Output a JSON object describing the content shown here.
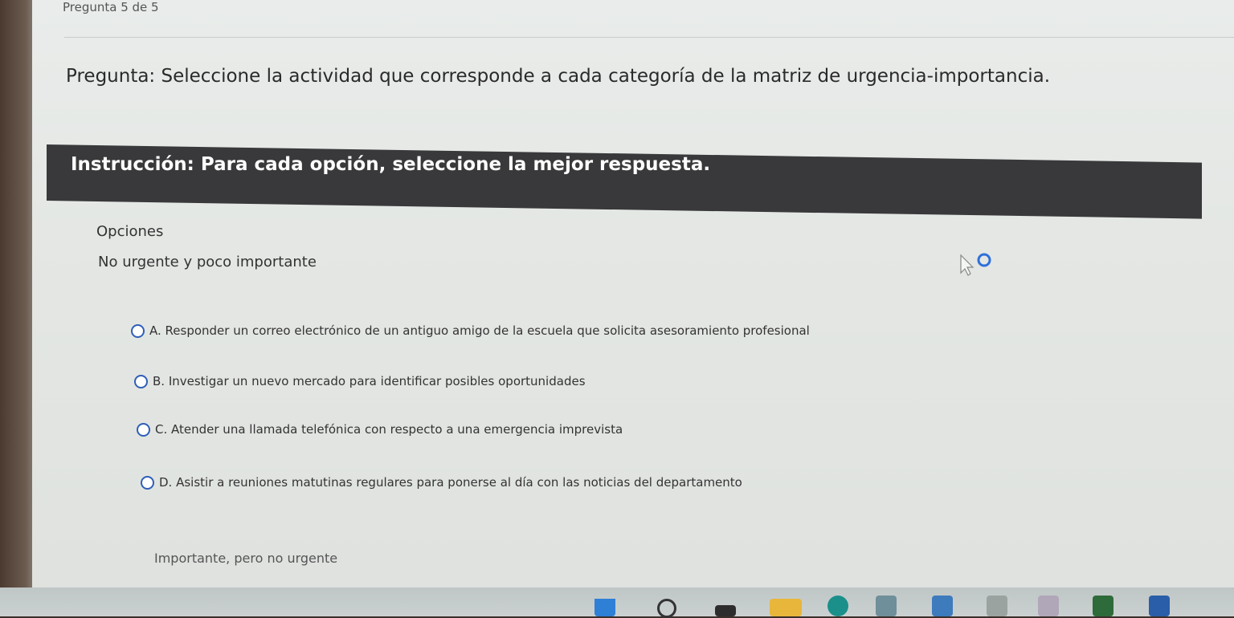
{
  "header": {
    "progress": "Pregunta 5 de 5"
  },
  "question": {
    "text": "Pregunta: Seleccione la actividad que corresponde a cada categoría de la matriz de urgencia-importancia."
  },
  "instruction": {
    "text": "Instrucción: Para cada opción, seleccione la mejor respuesta."
  },
  "options_section": {
    "heading": "Opciones",
    "current_category": "No urgente y poco importante",
    "choices": [
      {
        "label": "A. Responder un correo electrónico de un antiguo amigo de la escuela que solicita asesoramiento profesional"
      },
      {
        "label": "B. Investigar un nuevo mercado para identificar posibles oportunidades"
      },
      {
        "label": "C. Atender una llamada telefónica con respecto a una emergencia imprevista"
      },
      {
        "label": "D. Asistir a reuniones matutinas regulares para ponerse al día con las noticias del departamento"
      }
    ],
    "next_category": "Importante, pero no urgente"
  },
  "colors": {
    "instruction_bar": "#39393b",
    "radio_border": "#2f5fb8",
    "page_background": "#e4e7e4"
  },
  "taskbar": {
    "icons": [
      "start-icon",
      "search-icon",
      "taskview-icon",
      "file-explorer-icon",
      "edge-icon",
      "app-icon",
      "app-icon",
      "app-icon",
      "app-icon",
      "app-icon",
      "app-icon"
    ]
  }
}
